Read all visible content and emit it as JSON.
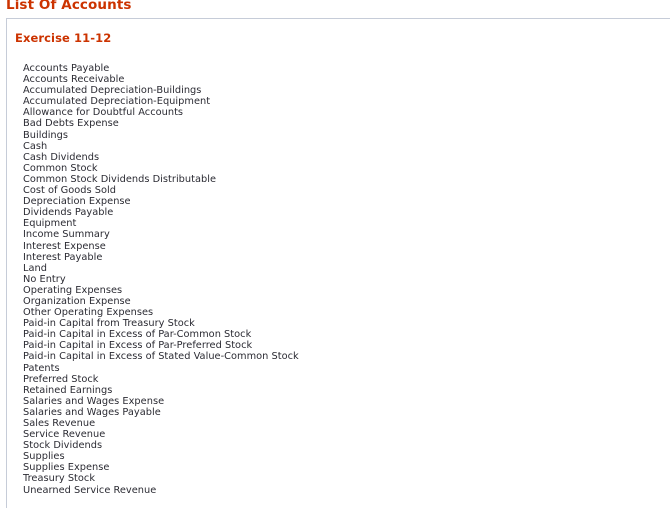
{
  "page": {
    "title": "List Of Accounts"
  },
  "panel": {
    "exercise_title": "Exercise 11-12",
    "accounts": [
      "Accounts Payable",
      "Accounts Receivable",
      "Accumulated Depreciation-Buildings",
      "Accumulated Depreciation-Equipment",
      "Allowance for Doubtful Accounts",
      "Bad Debts Expense",
      "Buildings",
      "Cash",
      "Cash Dividends",
      "Common Stock",
      "Common Stock Dividends Distributable",
      "Cost of Goods Sold",
      "Depreciation Expense",
      "Dividends Payable",
      "Equipment",
      "Income Summary",
      "Interest Expense",
      "Interest Payable",
      "Land",
      "No Entry",
      "Operating Expenses",
      "Organization Expense",
      "Other Operating Expenses",
      "Paid-in Capital from Treasury Stock",
      "Paid-in Capital in Excess of Par-Common Stock",
      "Paid-in Capital in Excess of Par-Preferred Stock",
      "Paid-in Capital in Excess of Stated Value-Common Stock",
      "Patents",
      "Preferred Stock",
      "Retained Earnings",
      "Salaries and Wages Expense",
      "Salaries and Wages Payable",
      "Sales Revenue",
      "Service Revenue",
      "Stock Dividends",
      "Supplies",
      "Supplies Expense",
      "Treasury Stock",
      "Unearned Service Revenue"
    ]
  },
  "colors": {
    "heading": "#cc3300",
    "border": "#c6ccd8",
    "text": "#2b2b33",
    "background": "#ffffff"
  }
}
